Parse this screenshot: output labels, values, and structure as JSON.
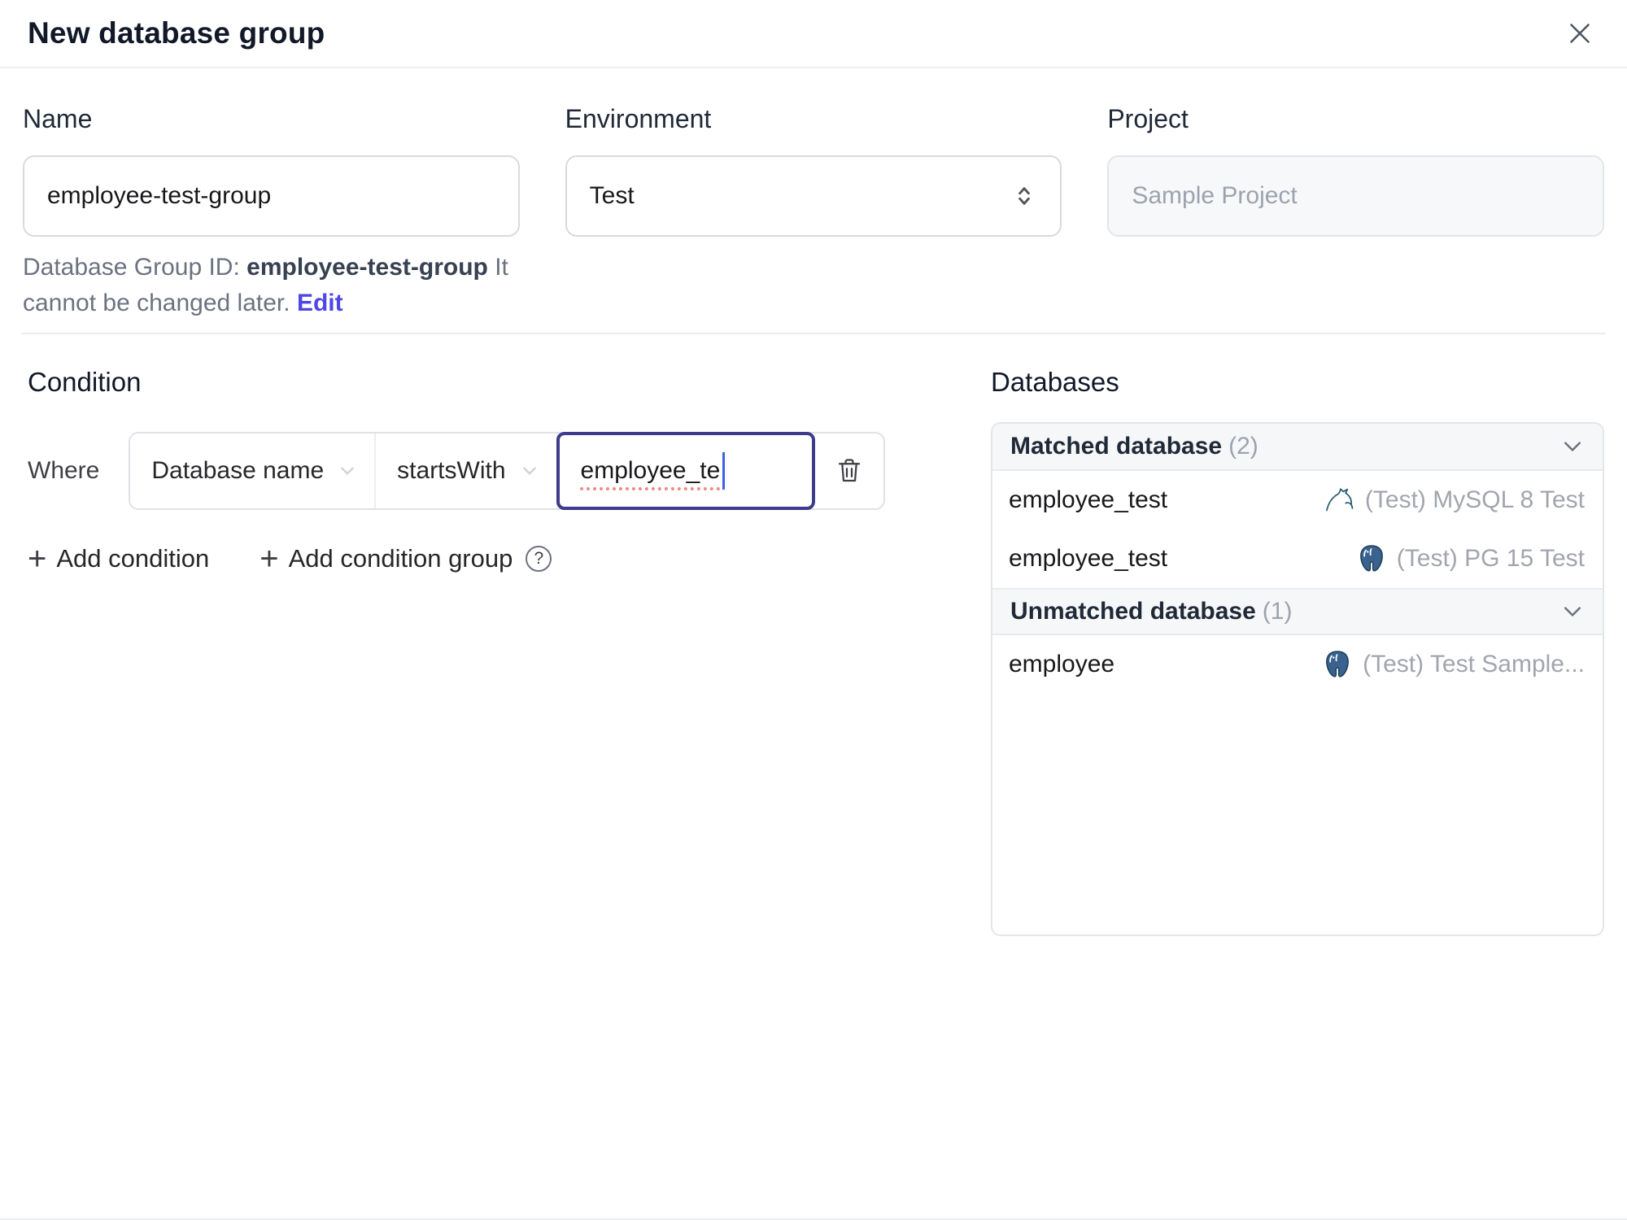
{
  "header": {
    "title": "New database group"
  },
  "form": {
    "name": {
      "label": "Name",
      "value": "employee-test-group"
    },
    "environment": {
      "label": "Environment",
      "value": "Test"
    },
    "project": {
      "label": "Project",
      "value": "Sample Project"
    },
    "group_id": {
      "prefix": "Database Group ID: ",
      "value": "employee-test-group",
      "suffix": " It cannot be changed later. ",
      "edit_label": "Edit"
    }
  },
  "condition": {
    "heading": "Condition",
    "where_label": "Where",
    "field": "Database name",
    "operator": "startsWith",
    "value": "employee_te",
    "add_condition": "Add condition",
    "add_condition_group": "Add condition group"
  },
  "databases": {
    "heading": "Databases",
    "matched": {
      "title": "Matched database",
      "count": "(2)",
      "rows": [
        {
          "name": "employee_test",
          "engine": "mysql",
          "instance": "(Test) MySQL 8 Test"
        },
        {
          "name": "employee_test",
          "engine": "postgresql",
          "instance": "(Test) PG 15 Test"
        }
      ]
    },
    "unmatched": {
      "title": "Unmatched database",
      "count": "(1)",
      "rows": [
        {
          "name": "employee",
          "engine": "postgresql",
          "instance": "(Test) Test Sample..."
        }
      ]
    }
  },
  "icons": {
    "plus": "+",
    "help": "?"
  },
  "colors": {
    "accent": "#4f46e5",
    "focus_border": "#3e3a8c",
    "spellcheck_underline": "#ef8a84",
    "postgres_blue": "#39638e",
    "mysql_teal": "#2b5d72"
  }
}
